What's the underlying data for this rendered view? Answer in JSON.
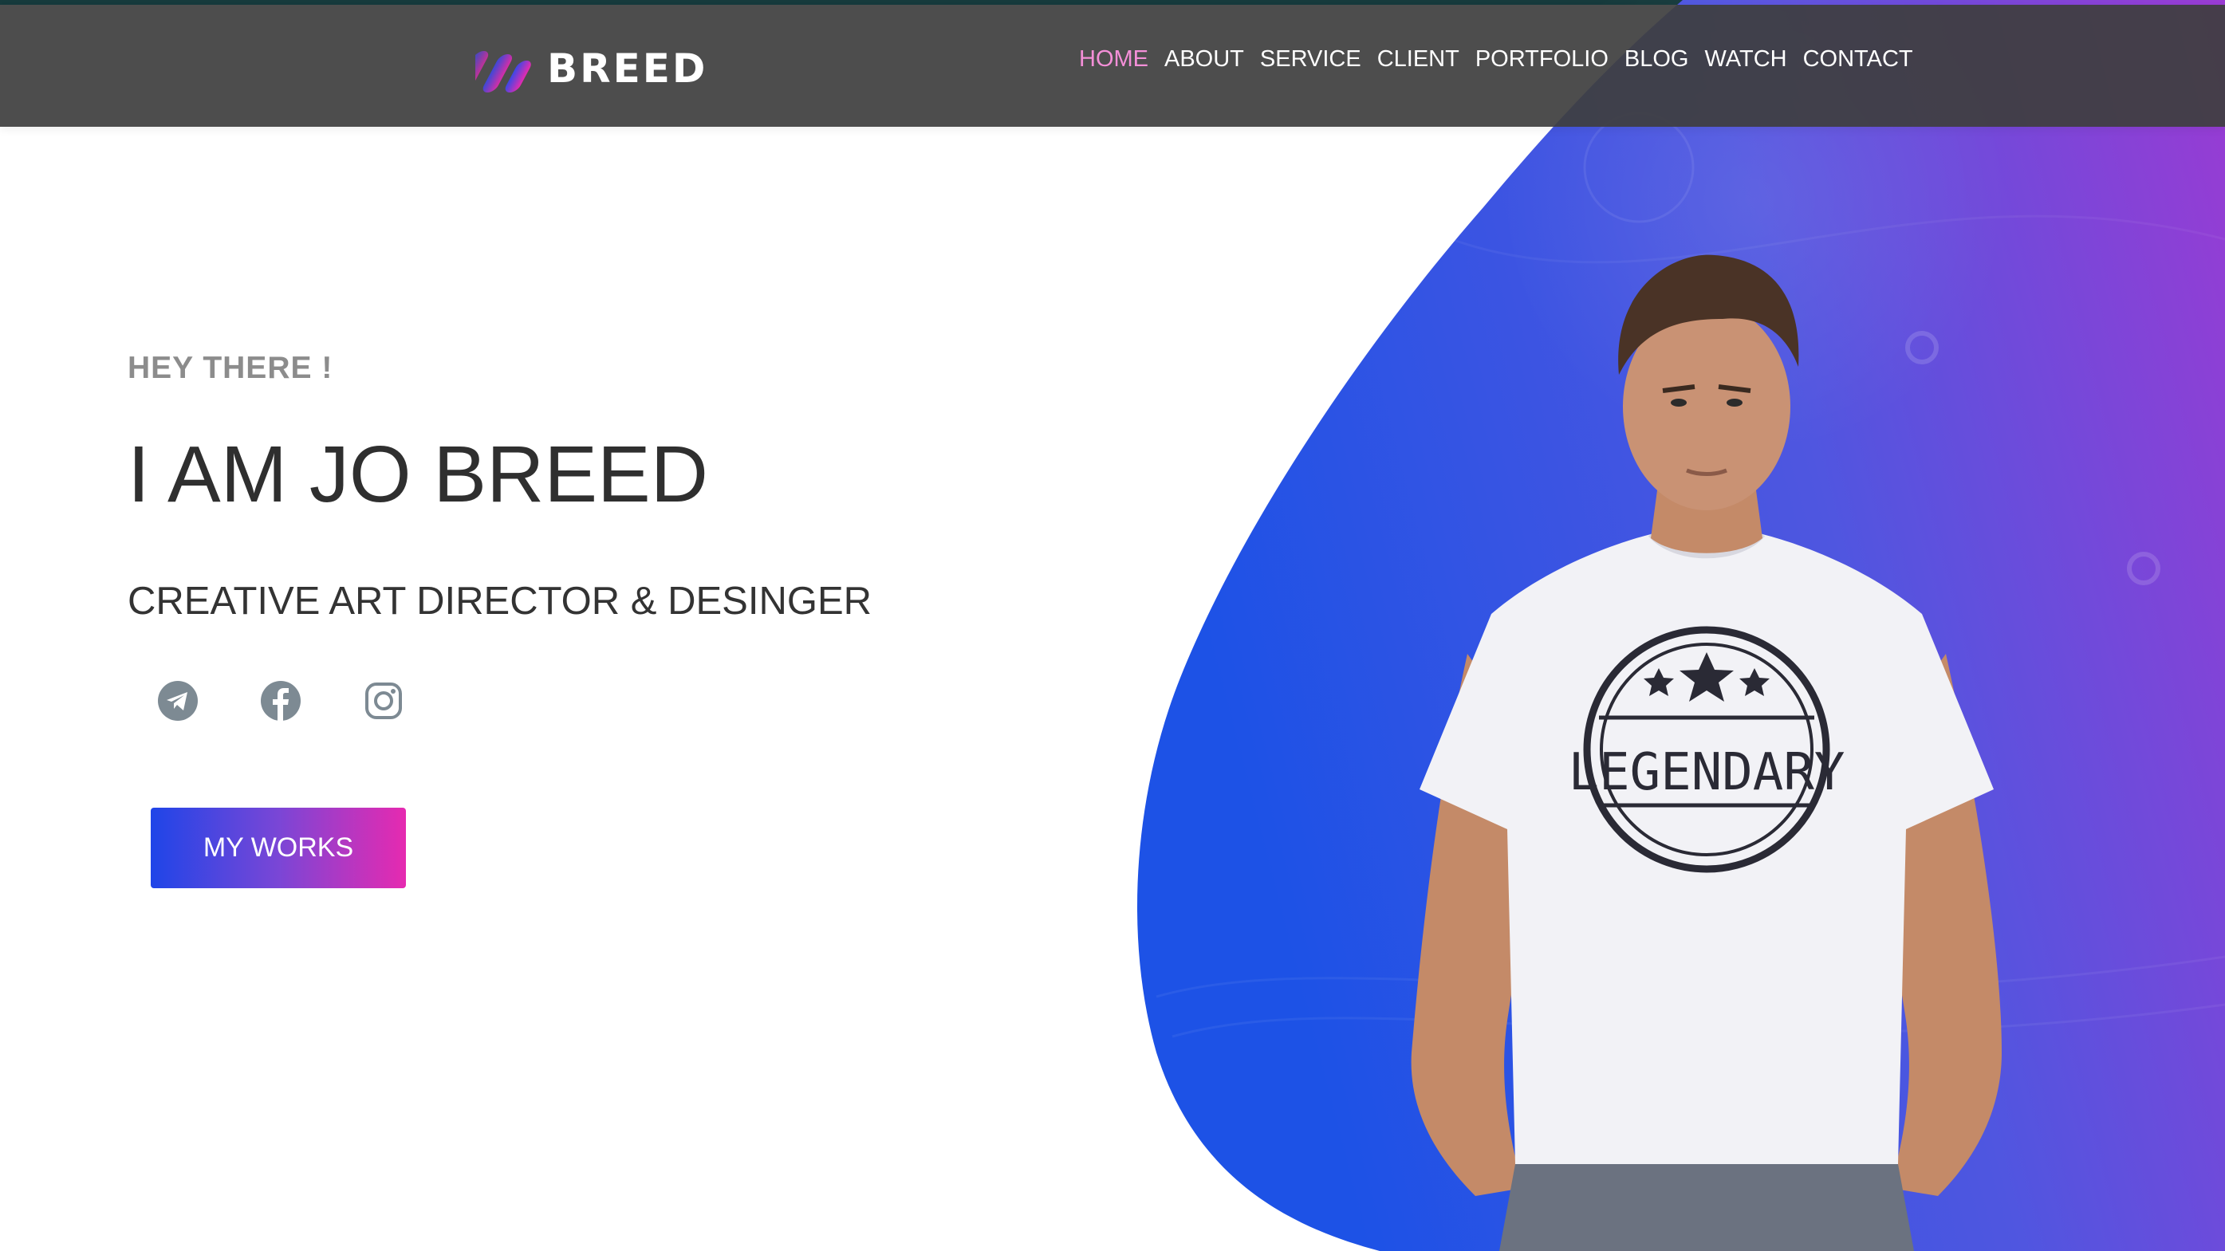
{
  "brand": {
    "name": "BREED",
    "logo_icon": "stripes-logo-icon"
  },
  "nav": {
    "items": [
      {
        "label": "HOME",
        "active": true
      },
      {
        "label": "ABOUT",
        "active": false
      },
      {
        "label": "SERVICE",
        "active": false
      },
      {
        "label": "CLIENT",
        "active": false
      },
      {
        "label": "PORTFOLIO",
        "active": false
      },
      {
        "label": "BLOG",
        "active": false
      },
      {
        "label": "WATCH",
        "active": false
      },
      {
        "label": "CONTACT",
        "active": false
      }
    ]
  },
  "hero": {
    "greeting": "HEY THERE !",
    "name": "I AM JO BREED",
    "role": "CREATIVE ART DIRECTOR & DESINGER",
    "cta_label": "MY WORKS",
    "socials": [
      {
        "icon": "telegram-icon"
      },
      {
        "icon": "facebook-icon"
      },
      {
        "icon": "instagram-icon"
      }
    ],
    "shirt_text": "LEGENDARY"
  },
  "colors": {
    "active_nav": "#f48fd8",
    "gradient_blue": "#1f45e8",
    "gradient_purple": "#8a3fd6",
    "gradient_pink": "#e62ab0",
    "header_bg": "#3e3e3e"
  }
}
